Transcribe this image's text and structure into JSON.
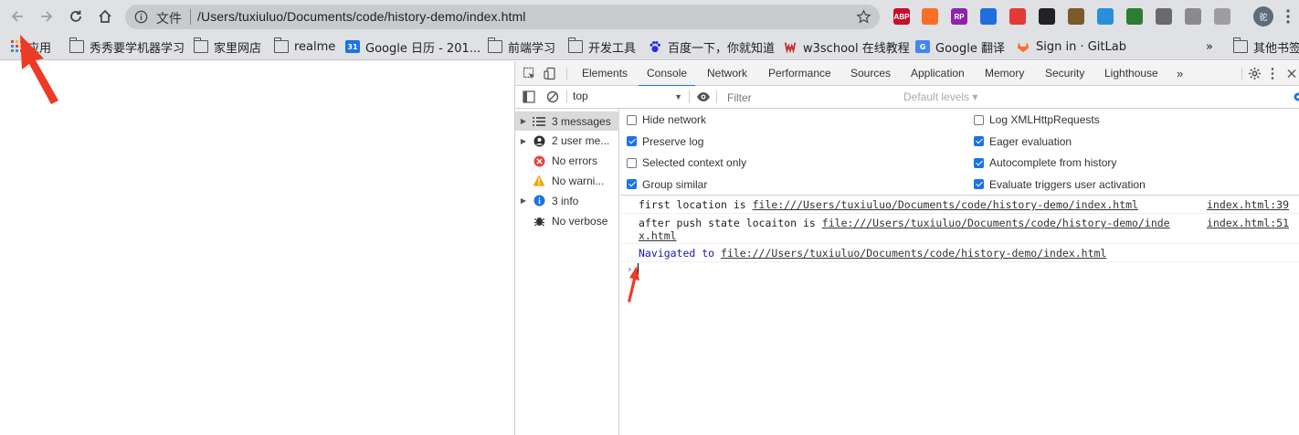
{
  "browser": {
    "scheme_label": "文件",
    "url": "/Users/tuxiuluo/Documents/code/history-demo/index.html",
    "profile_initial": "驼",
    "extensions": [
      {
        "name": "abp",
        "label": "ABP",
        "color": "#c70d2c"
      },
      {
        "name": "gitlab",
        "label": "",
        "color": "#fc6d26"
      },
      {
        "name": "rp",
        "label": "RP",
        "color": "#8e24aa"
      },
      {
        "name": "dropbox",
        "label": "",
        "color": "#1e6fdc"
      },
      {
        "name": "lock-ext",
        "label": "",
        "color": "#e53935"
      },
      {
        "name": "qr",
        "label": "",
        "color": "#222222"
      },
      {
        "name": "gardener",
        "label": "",
        "color": "#7a5a2a"
      },
      {
        "name": "xmind",
        "label": "",
        "color": "#2a8fd8"
      },
      {
        "name": "tree",
        "label": "",
        "color": "#2e7d32"
      },
      {
        "name": "vue",
        "label": "",
        "color": "#6a6a6a"
      },
      {
        "name": "square",
        "label": "",
        "color": "#8a8a8a"
      },
      {
        "name": "pen",
        "label": "",
        "color": "#9e9e9e"
      }
    ]
  },
  "bookmarks": {
    "apps_label": "应用",
    "items": [
      "秀秀要学机器学习",
      "家里网店",
      "realme",
      "Google 日历 - 201...",
      "前端学习",
      "开发工具",
      "百度一下，你就知道",
      "w3school 在线教程",
      "Google 翻译",
      "Sign in · GitLab"
    ],
    "more": "»",
    "other": "其他书签"
  },
  "devtools": {
    "tabs": [
      "Elements",
      "Console",
      "Network",
      "Performance",
      "Sources",
      "Application",
      "Memory",
      "Security",
      "Lighthouse"
    ],
    "more_tabs": "»",
    "context": "top",
    "filter_placeholder": "Filter",
    "levels": "Default levels ▾",
    "sidebar": [
      {
        "label": "3 messages",
        "icon": "list-icon",
        "expandable": true
      },
      {
        "label": "2 user me...",
        "icon": "user-icon",
        "expandable": true
      },
      {
        "label": "No errors",
        "icon": "error-icon",
        "expandable": false
      },
      {
        "label": "No warni...",
        "icon": "warning-icon",
        "expandable": false
      },
      {
        "label": "3 info",
        "icon": "info-icon",
        "expandable": true
      },
      {
        "label": "No verbose",
        "icon": "bug-icon",
        "expandable": false
      }
    ],
    "settings": {
      "left": [
        {
          "label": "Hide network",
          "checked": false
        },
        {
          "label": "Preserve log",
          "checked": true
        },
        {
          "label": "Selected context only",
          "checked": false
        },
        {
          "label": "Group similar",
          "checked": true
        }
      ],
      "right": [
        {
          "label": "Log XMLHttpRequests",
          "checked": false
        },
        {
          "label": "Eager evaluation",
          "checked": true
        },
        {
          "label": "Autocomplete from history",
          "checked": true
        },
        {
          "label": "Evaluate triggers user activation",
          "checked": true
        }
      ]
    },
    "messages": [
      {
        "prefix": "first location is ",
        "link": "file:///Users/tuxiuluo/Documents/code/history-demo/index.html",
        "source": "index.html:39"
      },
      {
        "prefix": "after push state locaiton is ",
        "link": "file:///Users/tuxiuluo/Documents/code/history-demo/inde",
        "link2": "x.html",
        "source": "index.html:51"
      },
      {
        "prefix": "Navigated to ",
        "link": "file:///Users/tuxiuluo/Documents/code/history-demo/index.html",
        "source": ""
      }
    ],
    "prompt_symbol": "›"
  }
}
